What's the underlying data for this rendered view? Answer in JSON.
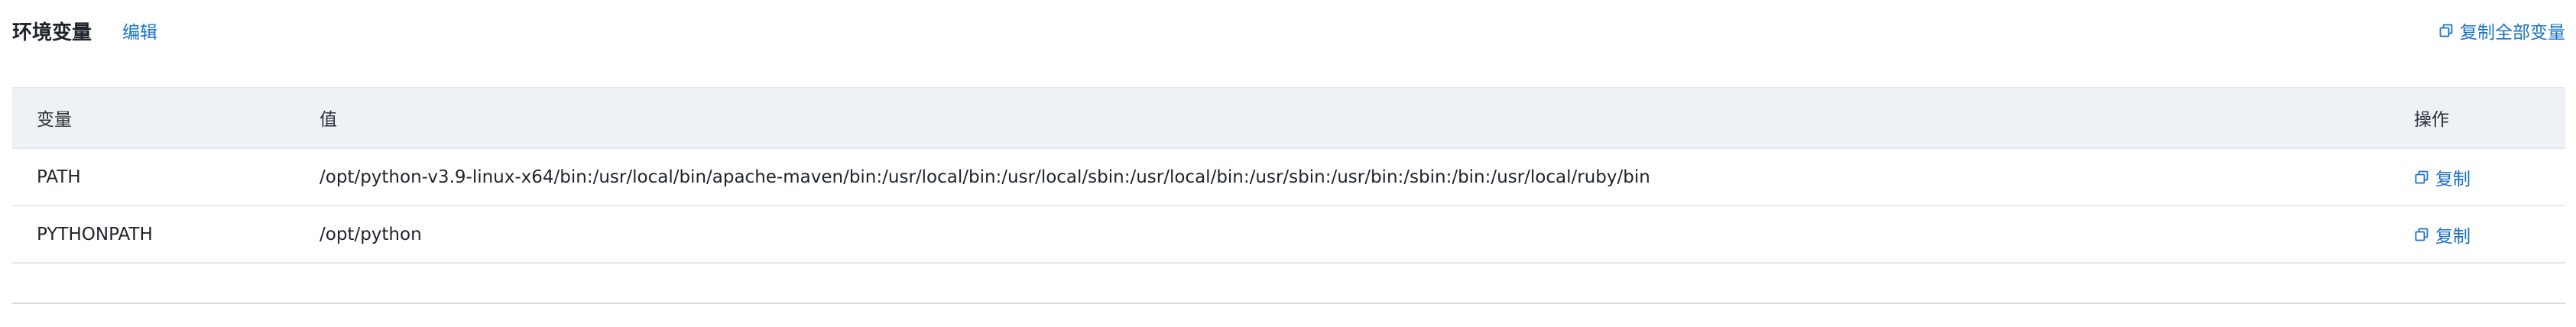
{
  "header": {
    "title": "环境变量",
    "edit_label": "编辑",
    "copy_all_label": "复制全部变量",
    "copy_all_icon": "copy-icon"
  },
  "table": {
    "columns": {
      "name": "变量",
      "value": "值",
      "action": "操作"
    },
    "rows": [
      {
        "name": "PATH",
        "value": "/opt/python-v3.9-linux-x64/bin:/usr/local/bin/apache-maven/bin:/usr/local/bin:/usr/local/sbin:/usr/local/bin:/usr/sbin:/usr/bin:/sbin:/bin:/usr/local/ruby/bin",
        "action": "复制"
      },
      {
        "name": "PYTHONPATH",
        "value": "/opt/python",
        "action": "复制"
      }
    ]
  },
  "colors": {
    "accent": "#1a73c8",
    "header_bg": "#eef1f5",
    "border": "#e4e7ec"
  }
}
